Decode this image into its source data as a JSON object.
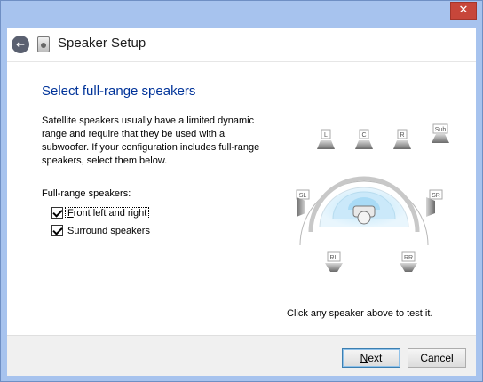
{
  "window": {
    "close_glyph": "✕"
  },
  "header": {
    "title": "Speaker Setup",
    "back_icon": "back-arrow-icon",
    "app_icon": "speaker-icon"
  },
  "main": {
    "heading": "Select full-range speakers",
    "description": "Satellite speakers usually have a limited dynamic range and require that they be used with a subwoofer.  If your configuration includes full-range speakers, select them below.",
    "group_label": "Full-range speakers:",
    "checkboxes": [
      {
        "label_accel": "F",
        "label_rest": "ront left and right",
        "checked": true
      },
      {
        "label_accel": "S",
        "label_rest": "urround speakers",
        "checked": true
      }
    ],
    "speaker_labels": {
      "L": "L",
      "C": "C",
      "R": "R",
      "Sub": "Sub",
      "SL": "SL",
      "SR": "SR",
      "RL": "RL",
      "RR": "RR"
    },
    "hint": "Click any speaker above to test it."
  },
  "footer": {
    "next_accel": "N",
    "next_rest": "ext",
    "cancel_label": "Cancel"
  },
  "colors": {
    "accent_heading": "#003399",
    "titlebar": "#a7c3ee",
    "close": "#c7463a"
  }
}
